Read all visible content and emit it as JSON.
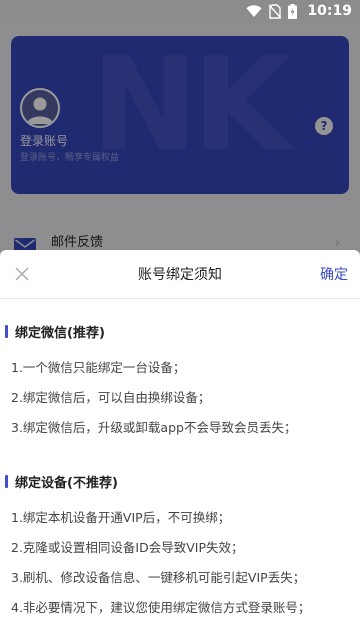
{
  "status_bar": {
    "time": "10:19"
  },
  "account_card": {
    "login_title": "登录账号",
    "login_subtitle": "登录账号，畅享专属权益",
    "help_label": "?"
  },
  "menu": {
    "feedback_label": "邮件反馈"
  },
  "sheet": {
    "title": "账号绑定须知",
    "confirm_label": "确定",
    "sections": [
      {
        "title": "绑定微信(推荐)",
        "items": [
          "1.一个微信只能绑定一台设备；",
          "2.绑定微信后，可以自由换绑设备；",
          "3.绑定微信后，升级或卸载app不会导致会员丢失；"
        ]
      },
      {
        "title": "绑定设备(不推荐)",
        "items": [
          "1.绑定本机设备开通VIP后，不可换绑；",
          "2.克隆或设置相同设备ID会导致VIP失效；",
          "3.刷机、修改设备信息、一键移机可能引起VIP丢失；",
          "4.非必要情况下，建议您使用绑定微信方式登录账号；"
        ]
      }
    ]
  },
  "colors": {
    "accent": "#3b48c5",
    "card": "#2d3b9b"
  }
}
